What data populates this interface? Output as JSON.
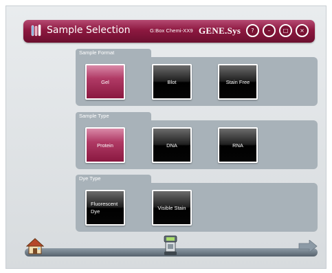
{
  "titlebar": {
    "title": "Sample Selection",
    "device": "G:Box Chemi-XX9",
    "brand": "GENE.Sys",
    "buttons": [
      {
        "name": "help",
        "symbol": "?"
      },
      {
        "name": "minimize",
        "symbol": "–"
      },
      {
        "name": "maximize",
        "symbol": "□"
      },
      {
        "name": "close",
        "symbol": "×"
      }
    ]
  },
  "groups": {
    "sample_format": {
      "label": "Sample Format",
      "options": [
        {
          "label": "Gel",
          "selected": true
        },
        {
          "label": "Blot",
          "selected": false
        },
        {
          "label": "Stain Free",
          "selected": false
        }
      ]
    },
    "sample_type": {
      "label": "Sample Type",
      "options": [
        {
          "label": "Protein",
          "selected": true
        },
        {
          "label": "DNA",
          "selected": false
        },
        {
          "label": "RNA",
          "selected": false
        }
      ]
    },
    "dye_type": {
      "label": "Dye Type",
      "options": [
        {
          "label": "Fluorescent Dye",
          "selected": false
        },
        {
          "label": "Visible Stain",
          "selected": false
        }
      ]
    }
  },
  "footer": {
    "icons": [
      "home-icon",
      "device-icon",
      "next-arrow-icon"
    ]
  },
  "colors": {
    "accent": "#8d1840",
    "selected": "#b03a65",
    "panel": "#a8b2b9"
  }
}
